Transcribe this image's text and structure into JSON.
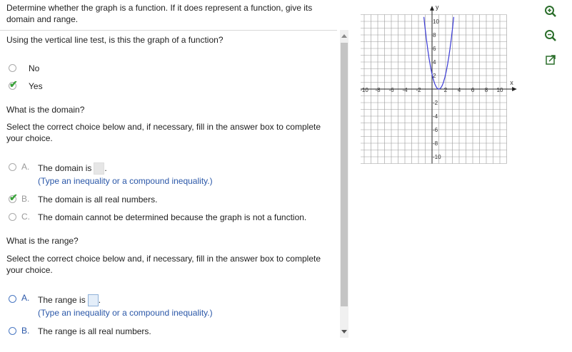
{
  "question": {
    "prompt": "Determine whether the graph is a function. If it does represent a function, give its domain and range."
  },
  "part1": {
    "question": "Using the vertical line test, is this the graph of a function?",
    "options": [
      {
        "label": "No",
        "selected": false
      },
      {
        "label": "Yes",
        "selected": true
      }
    ]
  },
  "domain": {
    "question": "What is the domain?",
    "instruction": "Select the correct choice below and, if necessary, fill in the answer box to complete your choice.",
    "options": [
      {
        "letter": "A.",
        "text": "The domain is",
        "suffix": ".",
        "hint": "(Type an inequality or a compound inequality.)"
      },
      {
        "letter": "B.",
        "text": "The domain is all real numbers.",
        "selected": true
      },
      {
        "letter": "C.",
        "text": "The domain cannot be determined because the graph is not a function."
      }
    ]
  },
  "range": {
    "question": "What is the range?",
    "instruction": "Select the correct choice below and, if necessary, fill in the answer box to complete your choice.",
    "options": [
      {
        "letter": "A.",
        "text": "The range is",
        "suffix": ".",
        "hint": "(Type an inequality or a compound inequality.)"
      },
      {
        "letter": "B.",
        "text": "The range is all real numbers."
      }
    ]
  },
  "graph": {
    "x_axis_label": "x",
    "y_axis_label": "y",
    "x_ticks": [
      "-10",
      "-8",
      "-6",
      "-4",
      "-2",
      "2",
      "4",
      "6",
      "8",
      "10"
    ],
    "y_ticks": [
      "10",
      "8",
      "6",
      "4",
      "2",
      "-2",
      "-4",
      "-6",
      "-8",
      "-10"
    ],
    "curve_color": "#3b3bd6",
    "curve": "parabola, vertex (1, 0), opening upward"
  },
  "tools": [
    {
      "icon": "zoom-in-icon"
    },
    {
      "icon": "zoom-out-icon"
    },
    {
      "icon": "pop-out-icon"
    }
  ]
}
